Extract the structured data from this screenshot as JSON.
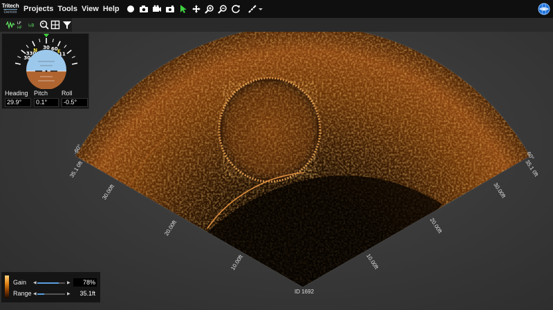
{
  "app": {
    "logo_line1": "Tritech",
    "logo_line2": "Gemini"
  },
  "menu": {
    "items": [
      "Projects",
      "Tools",
      "View",
      "Help"
    ]
  },
  "toolbar": {
    "icons": [
      "record-icon",
      "camera-icon",
      "video-icon",
      "snapshot-icon",
      "pointer-icon",
      "move-icon",
      "zoom-in-icon",
      "zoom-out-icon",
      "reset-view-icon",
      "measure-icon"
    ],
    "accent_color": "#3fd13f"
  },
  "subtoolbar": {
    "lf_label": "LF",
    "hf_label": "HF",
    "ib_label": "I₂B"
  },
  "attitude": {
    "compass_ticks": [
      "330",
      "N",
      "30",
      "60",
      "E",
      "11",
      "30"
    ],
    "heading_label": "Heading",
    "pitch_label": "Pitch",
    "roll_label": "Roll",
    "heading_value": "29.9°",
    "pitch_value": "0.1°",
    "roll_value": "-0.5°"
  },
  "sonar": {
    "range_labels_left": [
      "35.1 0ft",
      "30.00ft",
      "20.00ft",
      "10.00ft"
    ],
    "range_labels_right": [
      "35.1 0ft",
      "30.00ft",
      "20.00ft",
      "10.00ft"
    ],
    "angle_left": "-60°",
    "angle_right": "60°",
    "id_label": "ID 1692",
    "echo_color": "#d07a20"
  },
  "controls": {
    "gain_label": "Gain",
    "gain_value": "78%",
    "gain_fraction": 0.78,
    "range_label": "Range",
    "range_value": "35.1ft",
    "range_fraction": 0.25
  }
}
